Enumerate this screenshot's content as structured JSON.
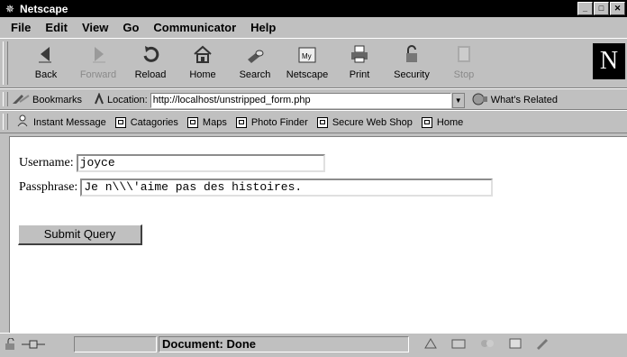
{
  "window": {
    "title": "Netscape"
  },
  "menu": [
    "File",
    "Edit",
    "View",
    "Go",
    "Communicator",
    "Help"
  ],
  "nav": {
    "back": "Back",
    "forward": "Forward",
    "reload": "Reload",
    "home": "Home",
    "search": "Search",
    "netscape": "Netscape",
    "print": "Print",
    "security": "Security",
    "stop": "Stop"
  },
  "location": {
    "bookmarks_label": "Bookmarks",
    "label": "Location:",
    "url": "http://localhost/unstripped_form.php",
    "whats_related": "What's Related"
  },
  "personal": {
    "instant_message": "Instant Message",
    "catagories": "Catagories",
    "maps": "Maps",
    "photo_finder": "Photo Finder",
    "secure_web_shop": "Secure Web Shop",
    "home": "Home"
  },
  "form": {
    "username_label": "Username:",
    "username_value": "joyce",
    "passphrase_label": "Passphrase:",
    "passphrase_value": "Je n\\\\\\'aime pas des histoires.",
    "submit_label": "Submit Query"
  },
  "status": {
    "text": "Document: Done"
  }
}
